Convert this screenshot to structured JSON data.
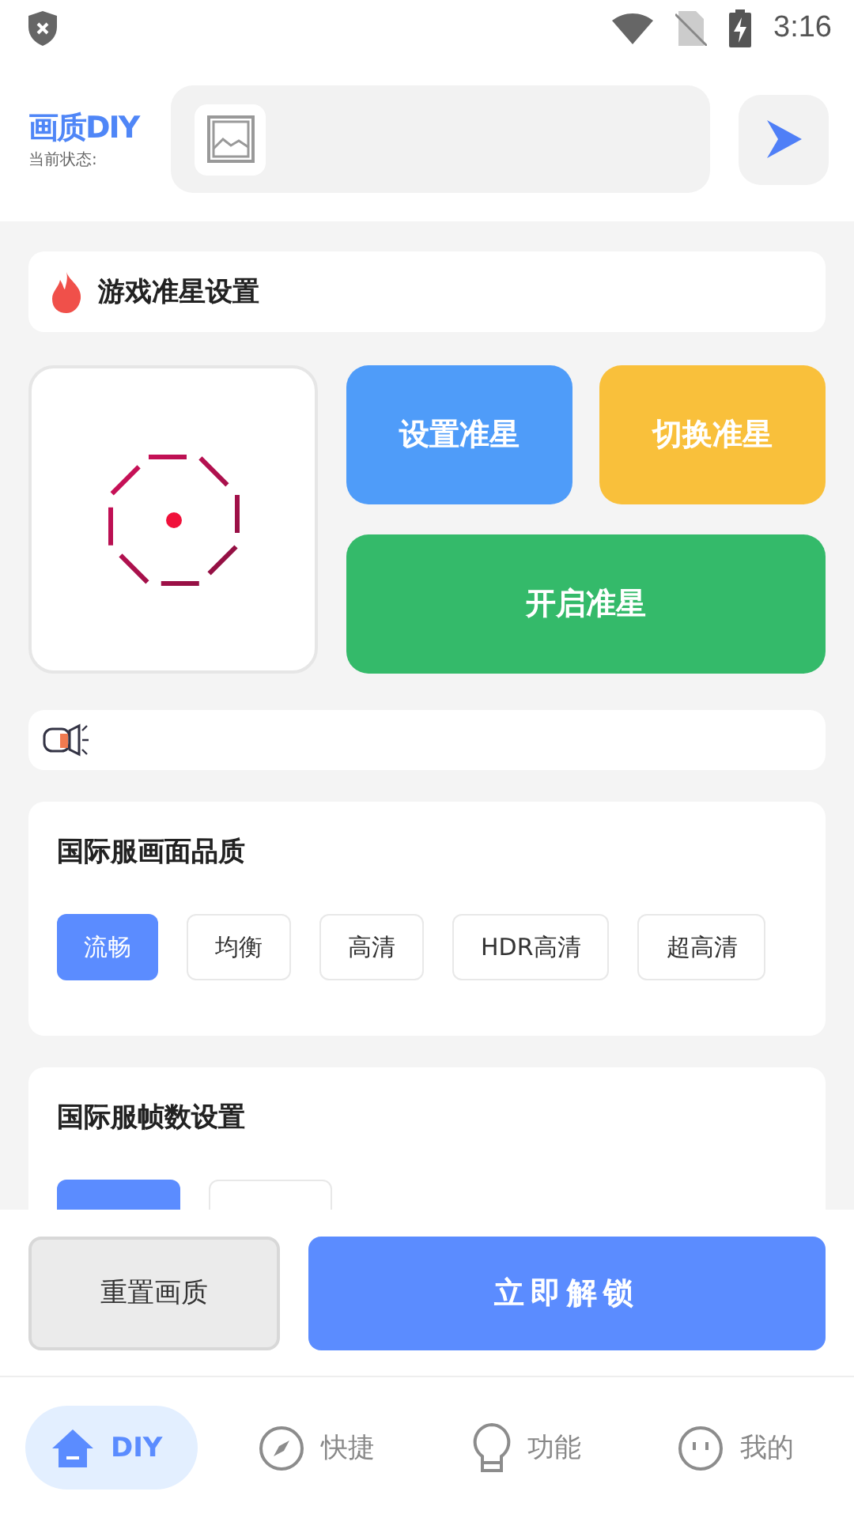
{
  "status_bar": {
    "time": "3:16"
  },
  "header": {
    "title": "画质DIY",
    "subtitle": "当前状态:"
  },
  "crosshair_section": {
    "title": "游戏准星设置",
    "buttons": [
      {
        "label": "设置准星",
        "kind": "set"
      },
      {
        "label": "切换准星",
        "kind": "switch"
      },
      {
        "label": "开启准星",
        "kind": "enable"
      }
    ]
  },
  "quality_card": {
    "title": "国际服画面品质",
    "options": [
      {
        "label": "流畅",
        "selected": true
      },
      {
        "label": "均衡",
        "selected": false
      },
      {
        "label": "高清",
        "selected": false
      },
      {
        "label": "HDR高清",
        "selected": false
      },
      {
        "label": "超高清",
        "selected": false
      }
    ]
  },
  "fps_card": {
    "title": "国际服帧数设置",
    "options": [
      {
        "selected": true
      },
      {
        "selected": false
      }
    ]
  },
  "actions": {
    "reset": "重置画质",
    "unlock": "立即解锁"
  },
  "nav": [
    {
      "label": "DIY",
      "selected": true
    },
    {
      "label": "快捷",
      "selected": false
    },
    {
      "label": "功能",
      "selected": false
    },
    {
      "label": "我的",
      "selected": false
    }
  ]
}
